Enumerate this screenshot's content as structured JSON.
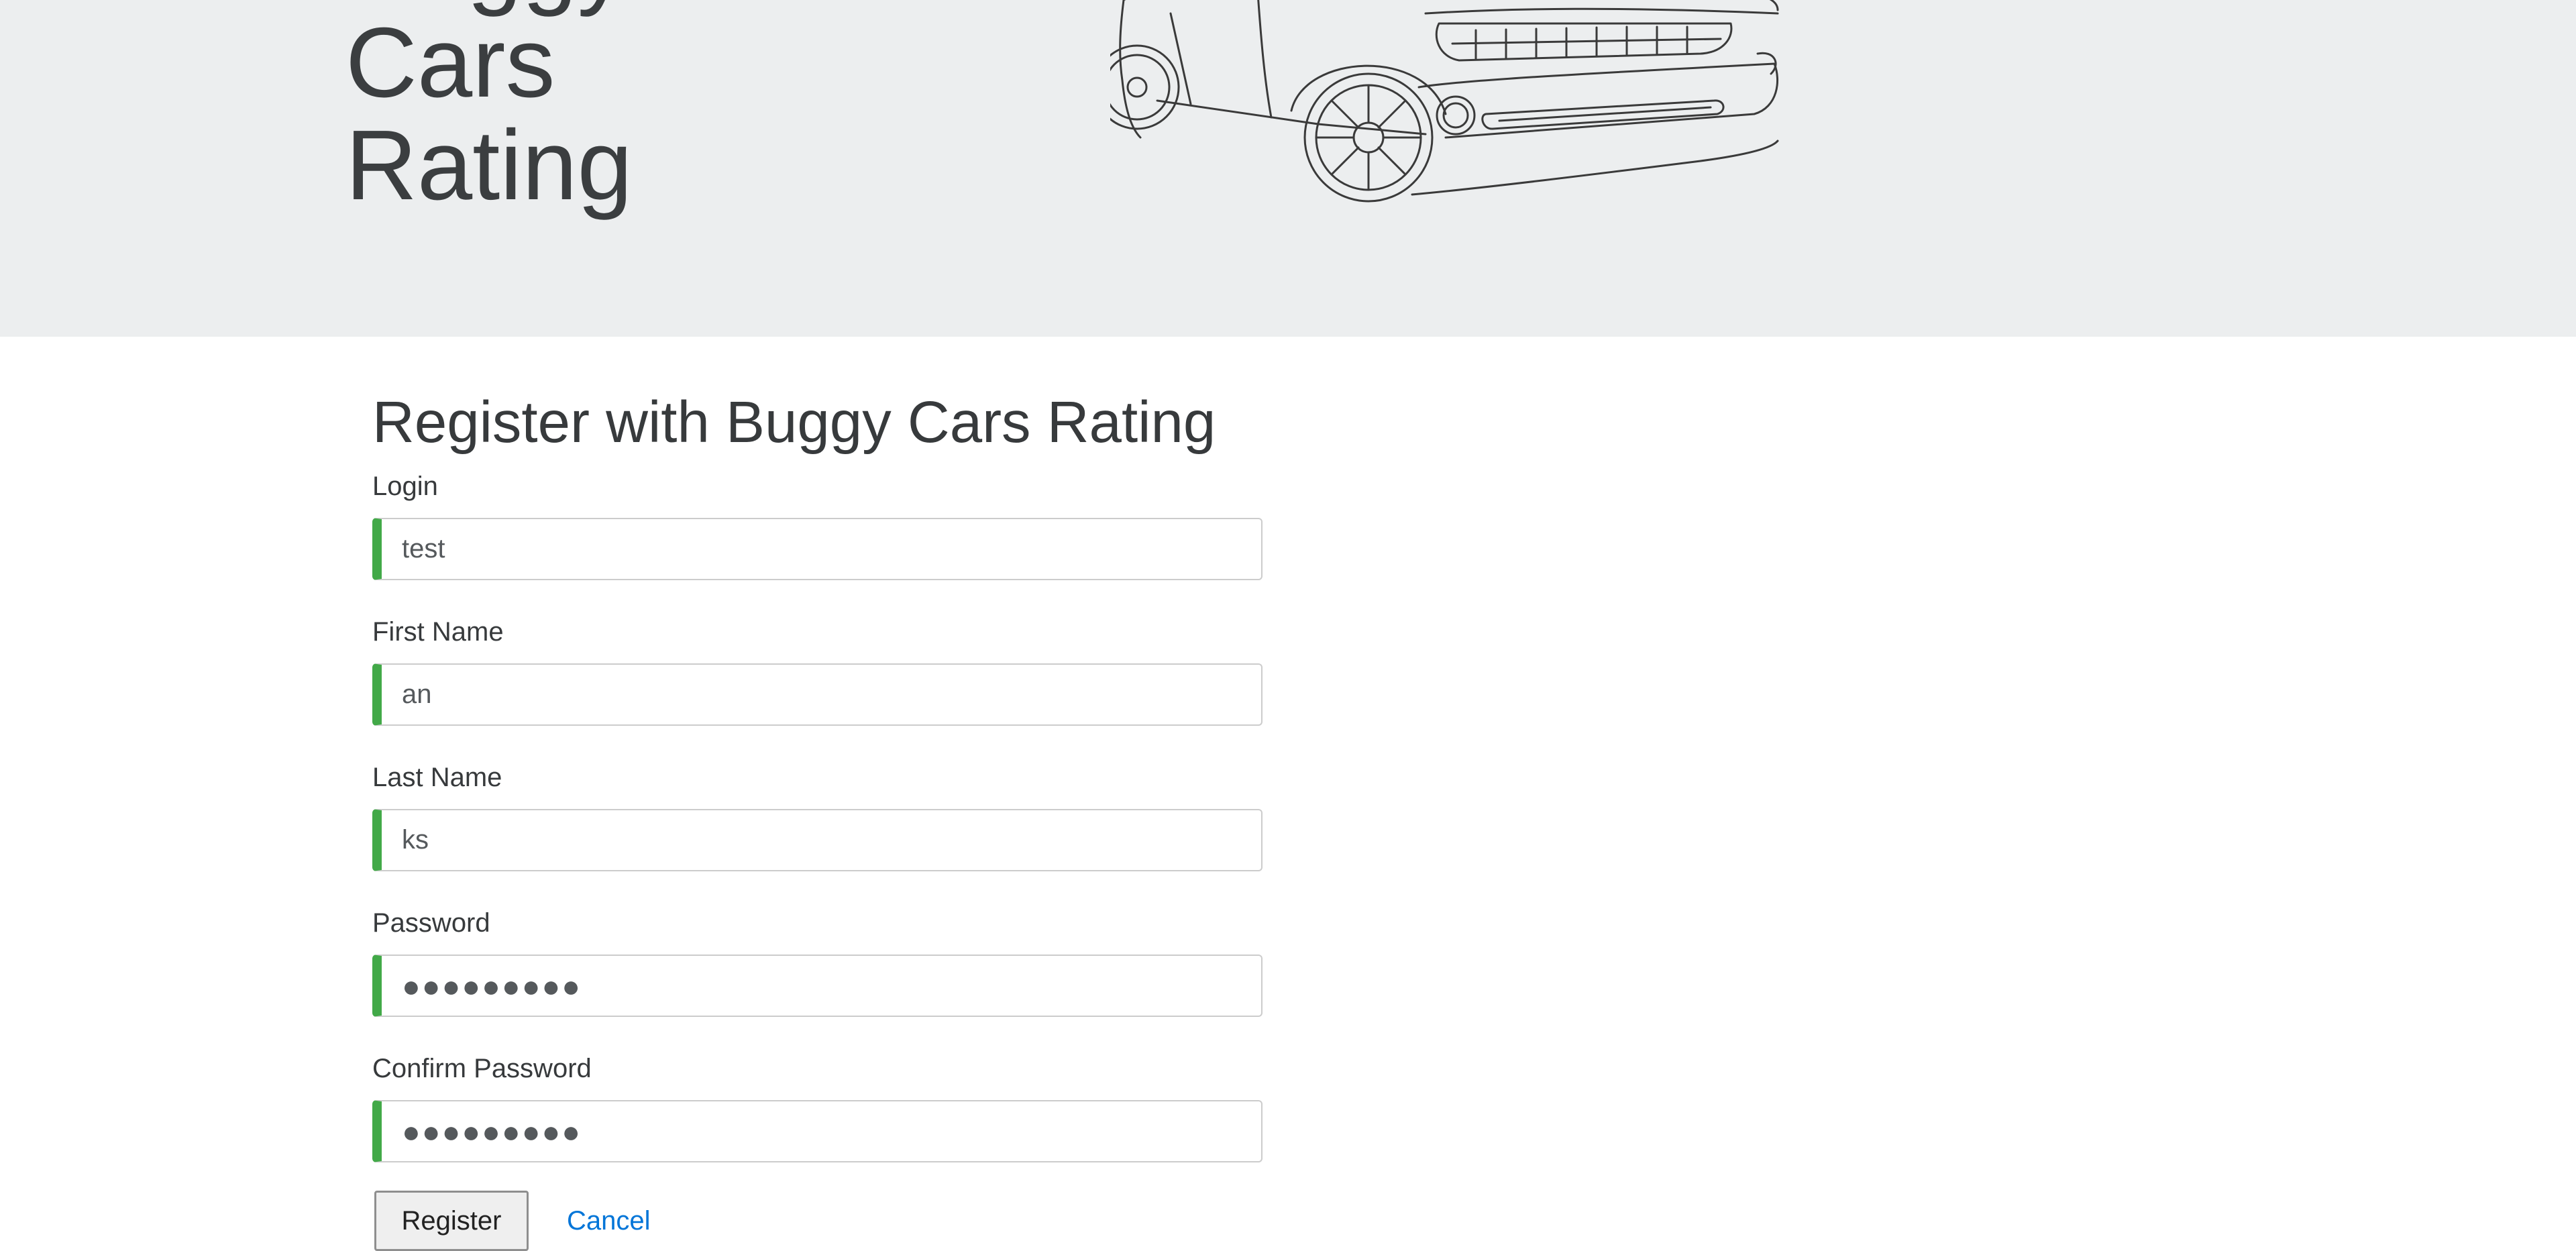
{
  "header": {
    "brand_lines": [
      "Buggy",
      "Cars",
      "Rating"
    ]
  },
  "form": {
    "title": "Register with Buggy Cars Rating",
    "fields": [
      {
        "label": "Login",
        "value": "test"
      },
      {
        "label": "First Name",
        "value": "an"
      },
      {
        "label": "Last Name",
        "value": "ks"
      },
      {
        "label": "Password",
        "value": "●●●●●●●●●"
      },
      {
        "label": "Confirm Password",
        "value": "●●●●●●●●●"
      }
    ],
    "register_label": "Register",
    "cancel_label": "Cancel"
  },
  "colors": {
    "hero_bg": "#eceeef",
    "valid_border": "#42a948",
    "link": "#0275d8"
  },
  "icons": {
    "hero_image": "car-illustration"
  }
}
